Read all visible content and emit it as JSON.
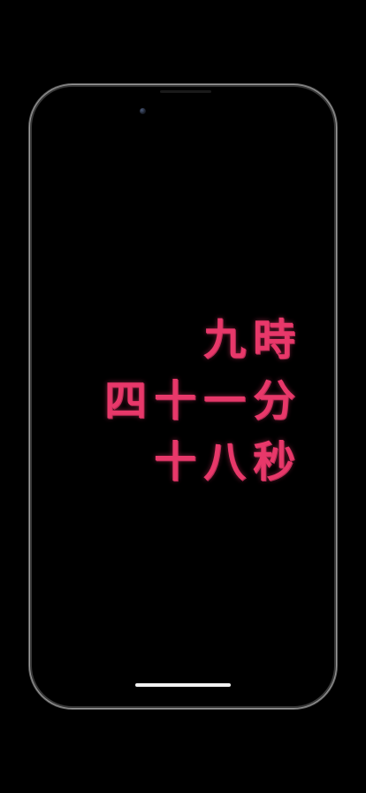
{
  "clock": {
    "hour": "九時",
    "minute": "四十一分",
    "second": "十八秒",
    "color": "#e8386a"
  },
  "device": {
    "frame_color": "#9a9a9a",
    "screen_color": "#000000"
  }
}
